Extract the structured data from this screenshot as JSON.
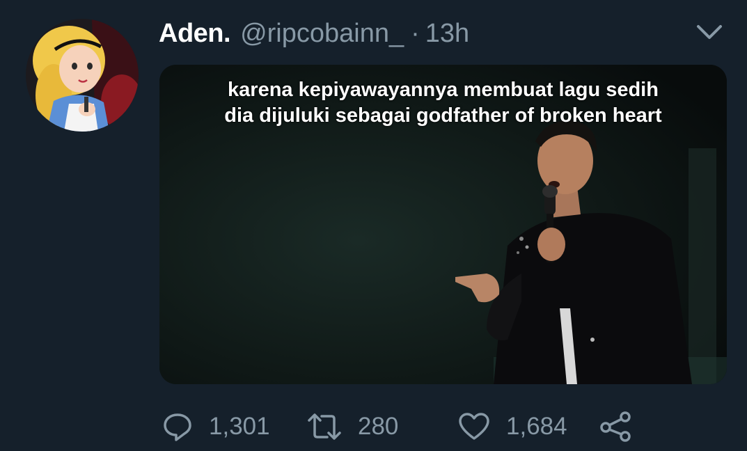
{
  "tweet": {
    "display_name": "Aden.",
    "handle": "@ripcobainn_",
    "separator": "·",
    "time": "13h",
    "media": {
      "caption_line1": "karena kepiyawayannya membuat lagu sedih",
      "caption_line2": "dia dijuluki sebagai godfather of broken heart"
    },
    "actions": {
      "reply_count": "1,301",
      "retweet_count": "280",
      "like_count": "1,684"
    }
  },
  "icons": {
    "caret": "chevron-down-icon",
    "reply": "reply-icon",
    "retweet": "retweet-icon",
    "like": "heart-icon",
    "share": "share-icon"
  },
  "colors": {
    "background": "#15202b",
    "secondary_text": "#8899a6",
    "primary_text": "#ffffff"
  }
}
